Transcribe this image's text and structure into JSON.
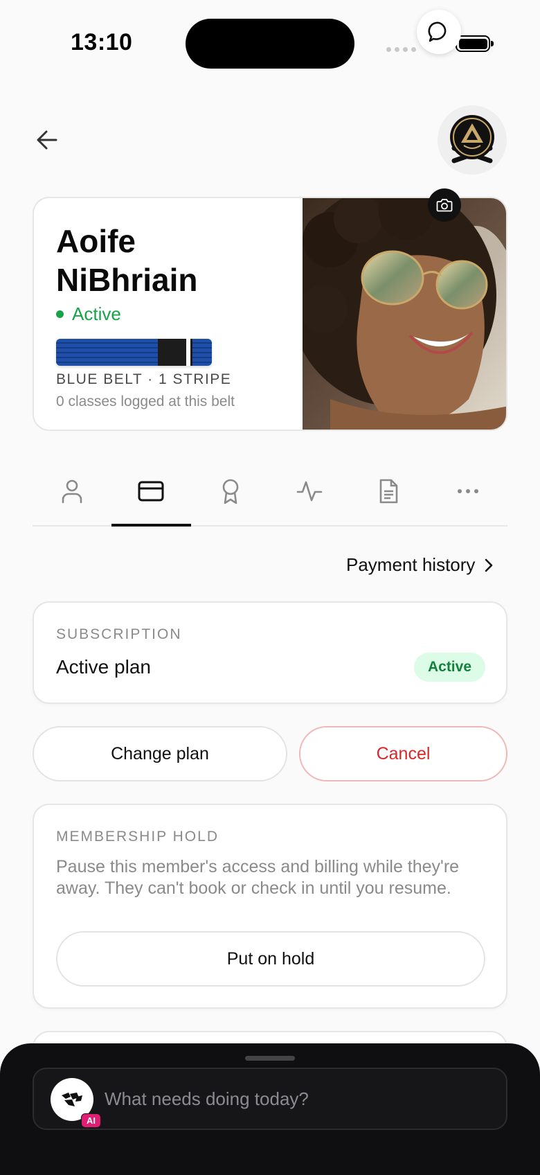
{
  "status_bar": {
    "time": "13:10"
  },
  "member": {
    "name": "Aoife NiBhriain",
    "status": "Active",
    "belt_label": "BLUE BELT · 1 STRIPE",
    "belt_classes": "0 classes logged at this belt",
    "belt_color": "#1f4fa8",
    "stripes": 1
  },
  "tabs": [
    {
      "icon": "person-icon",
      "active": false
    },
    {
      "icon": "credit-card-icon",
      "active": true
    },
    {
      "icon": "award-icon",
      "active": false
    },
    {
      "icon": "activity-icon",
      "active": false
    },
    {
      "icon": "document-icon",
      "active": false
    },
    {
      "icon": "more-icon",
      "active": false
    }
  ],
  "payment_history": {
    "label": "Payment history"
  },
  "subscription": {
    "section_label": "SUBSCRIPTION",
    "plan_title": "Active plan",
    "badge": "Active"
  },
  "actions": {
    "change_plan": "Change plan",
    "cancel": "Cancel"
  },
  "membership_hold": {
    "section_label": "MEMBERSHIP HOLD",
    "description": "Pause this member's access and billing while they're away. They can't book or check in until you resume.",
    "button": "Put on hold"
  },
  "ai_assistant": {
    "placeholder": "What needs doing today?",
    "chip": "AI"
  },
  "colors": {
    "active_green": "#16a34a",
    "danger_red": "#dc2626",
    "badge_bg": "#dcfce7"
  }
}
